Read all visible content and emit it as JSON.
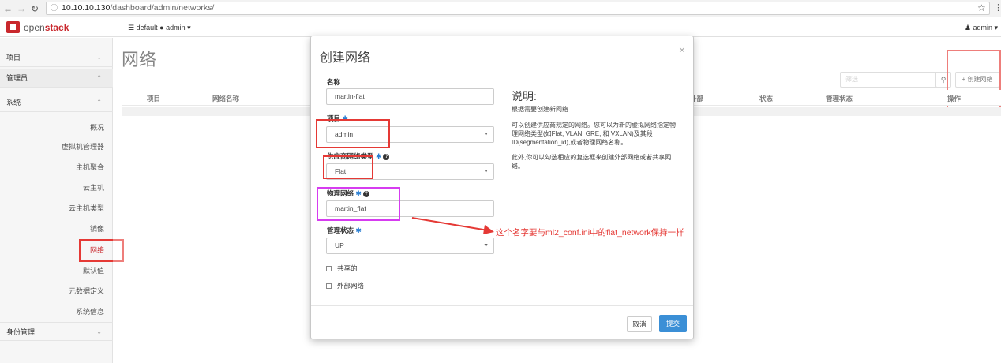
{
  "browser": {
    "url_host": "10.10.10.130",
    "url_path": "/dashboard/admin/networks/",
    "back_icon": "arrow-left-icon",
    "forward_icon": "arrow-right-icon",
    "reload_icon": "reload-icon",
    "star_icon": "star-icon",
    "menu_icon": "kebab-menu-icon"
  },
  "topnav": {
    "brand_open": "open",
    "brand_stack": "stack",
    "project_domain": "default",
    "project_user": "admin",
    "user_name": "admin"
  },
  "sidebar": {
    "sections": [
      {
        "label": "项目"
      },
      {
        "label": "管理员"
      },
      {
        "label": "系统"
      }
    ],
    "items": [
      {
        "label": "概况"
      },
      {
        "label": "虚拟机管理器"
      },
      {
        "label": "主机聚合"
      },
      {
        "label": "云主机"
      },
      {
        "label": "云主机类型"
      },
      {
        "label": "镜像"
      },
      {
        "label": "网络"
      },
      {
        "label": "默认值"
      },
      {
        "label": "元数据定义"
      },
      {
        "label": "系统信息"
      }
    ],
    "identity_section": "身份管理"
  },
  "main": {
    "title": "网络",
    "search_placeholder": "筛选",
    "create_button": "+ 创建网络",
    "columns": [
      "项目",
      "网络名称",
      "外部",
      "状态",
      "管理状态",
      "操作"
    ]
  },
  "modal": {
    "title": "创建网络",
    "name_label": "名称",
    "name_value": "martin-flat",
    "project_label": "项目",
    "project_value": "admin",
    "provider_type_label": "供应商网络类型",
    "provider_type_value": "Flat",
    "physical_network_label": "物理网络",
    "physical_network_value": "martin_flat",
    "admin_state_label": "管理状态",
    "admin_state_value": "UP",
    "shared_label": "共享的",
    "external_label": "外部网络",
    "desc_title": "说明:",
    "desc_p1": "根据需要创建新网络",
    "desc_p2": "可以创建供应商规定的网络。您可以为新的虚拟网络指定物理网络类型(如Flat, VLAN, GRE, 和 VXLAN)及其段ID(segmentation_id),或者物理网络名称。",
    "desc_p3": "此外,你可以勾选相应的复选框来创建外部网络或者共享网络。",
    "cancel_label": "取消",
    "submit_label": "提交"
  },
  "annotation": {
    "text": "这个名字要与ml2_conf.ini中的flat_network保持一样"
  },
  "colors": {
    "brand_red": "#c9282d",
    "annotation_red": "#e53935",
    "annotation_purple": "#d63cf0",
    "primary_blue": "#3b8fd6",
    "required_blue": "#2a7fd3"
  }
}
